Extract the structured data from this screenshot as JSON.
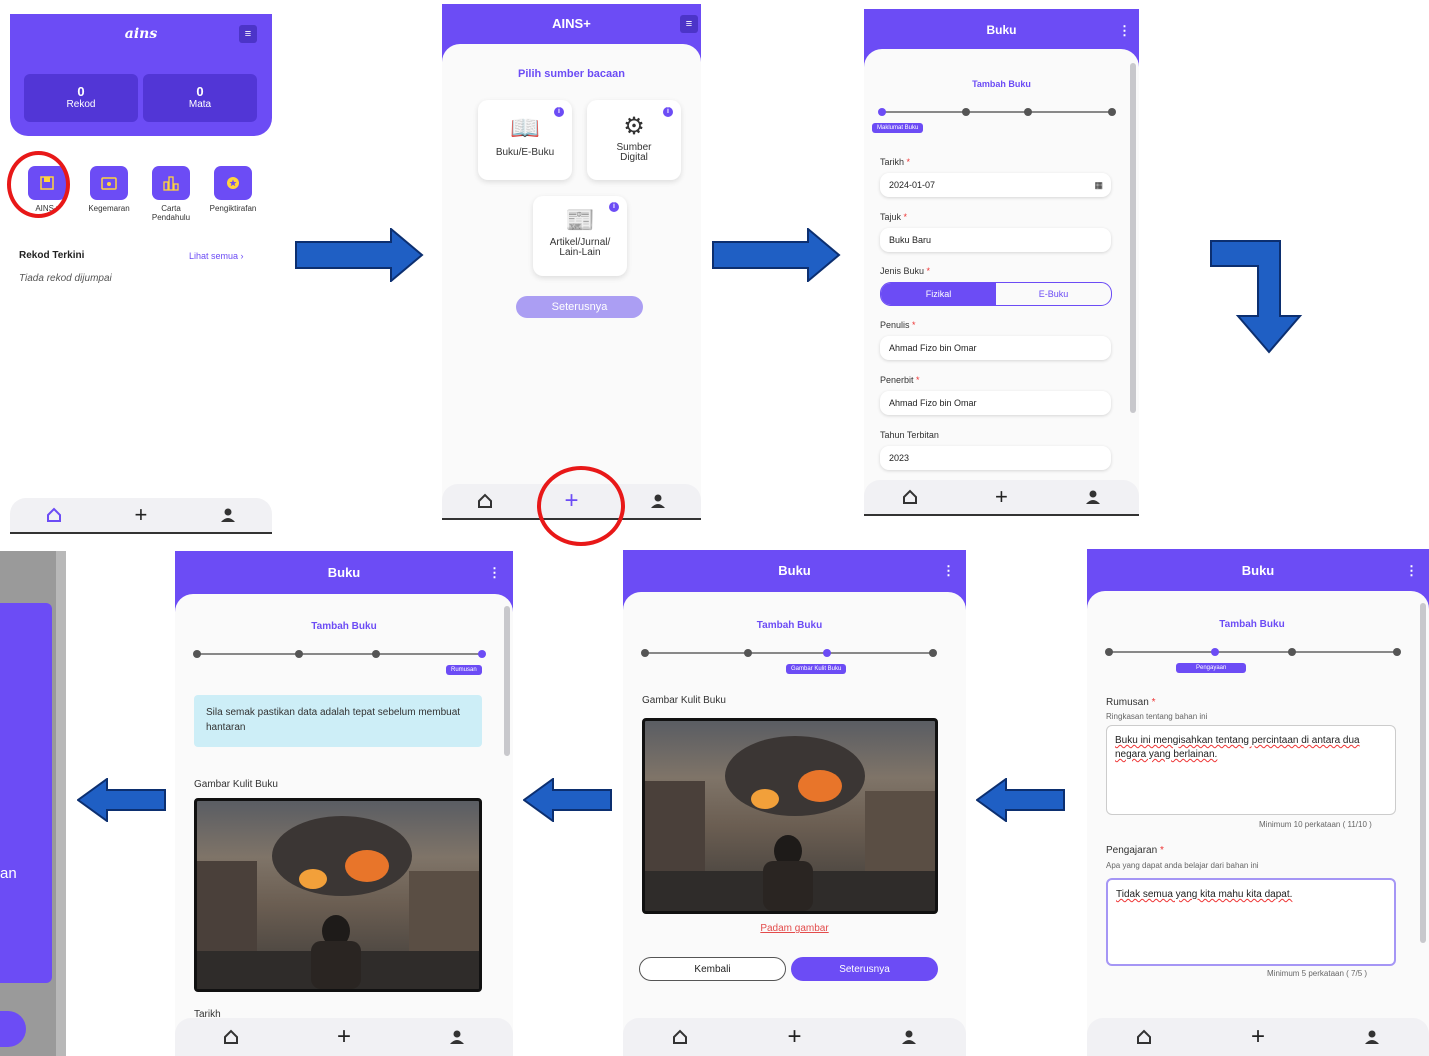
{
  "screen1": {
    "title": "ains",
    "stats": [
      {
        "value": "0",
        "label": "Rekod"
      },
      {
        "value": "0",
        "label": "Mata"
      }
    ],
    "actions": [
      "AINS+",
      "Kegemaran",
      "Carta Pendahulu",
      "Pengiktirafan"
    ],
    "recent_title": "Rekod Terkini",
    "see_all": "Lihat semua",
    "empty": "Tiada rekod dijumpai"
  },
  "screen2": {
    "title": "AINS+",
    "prompt": "Pilih sumber bacaan",
    "sources": [
      "Buku/E-Buku",
      "Sumber Digital",
      "Artikel/Jurnal/ Lain-Lain"
    ],
    "next": "Seterusnya"
  },
  "screen3": {
    "title": "Buku",
    "subtitle": "Tambah Buku",
    "step_label": "Maklumat Buku",
    "fields": [
      {
        "label": "Tarikh",
        "value": "2024-01-07"
      },
      {
        "label": "Tajuk",
        "value": "Buku Baru"
      },
      {
        "label": "Penulis",
        "value": "Ahmad Fizo bin Omar"
      },
      {
        "label": "Penerbit",
        "value": "Ahmad Fizo bin Omar"
      },
      {
        "label": "Tahun Terbitan",
        "value": "2023"
      }
    ],
    "type_label": "Jenis Buku",
    "type_options": [
      "Fizikal",
      "E-Buku"
    ]
  },
  "screen4": {
    "title": "Buku",
    "subtitle": "Tambah Buku",
    "step_label": "Pengayaan",
    "summary_label": "Rumusan",
    "summary_hint": "Ringkasan tentang bahan ini",
    "summary_value": "Buku ini mengisahkan tentang percintaan di antara dua negara yang berlainan.",
    "summary_count": "Minimum 10 perkataan ( 11/10 )",
    "lesson_label": "Pengajaran",
    "lesson_hint": "Apa yang dapat anda belajar dari bahan ini",
    "lesson_value": "Tidak semua yang kita mahu kita dapat.",
    "lesson_count": "Minimum 5 perkataan ( 7/5 )"
  },
  "screen5": {
    "title": "Buku",
    "subtitle": "Tambah Buku",
    "step_label": "Gambar Kulit Buku",
    "image_label": "Gambar Kulit Buku",
    "delete": "Padam gambar",
    "back": "Kembali",
    "next": "Seterusnya"
  },
  "screen6": {
    "title": "Buku",
    "subtitle": "Tambah Buku",
    "step_label": "Rumusan",
    "notice": "Sila semak pastikan data adalah tepat sebelum membuat hantaran",
    "image_label": "Gambar Kulit Buku",
    "date_label": "Tarikh"
  },
  "screen7": {
    "partial_text": "an"
  },
  "colors": {
    "brand": "#6c4cf5",
    "arrow": "#1f5fc4",
    "highlight": "#e81818"
  }
}
